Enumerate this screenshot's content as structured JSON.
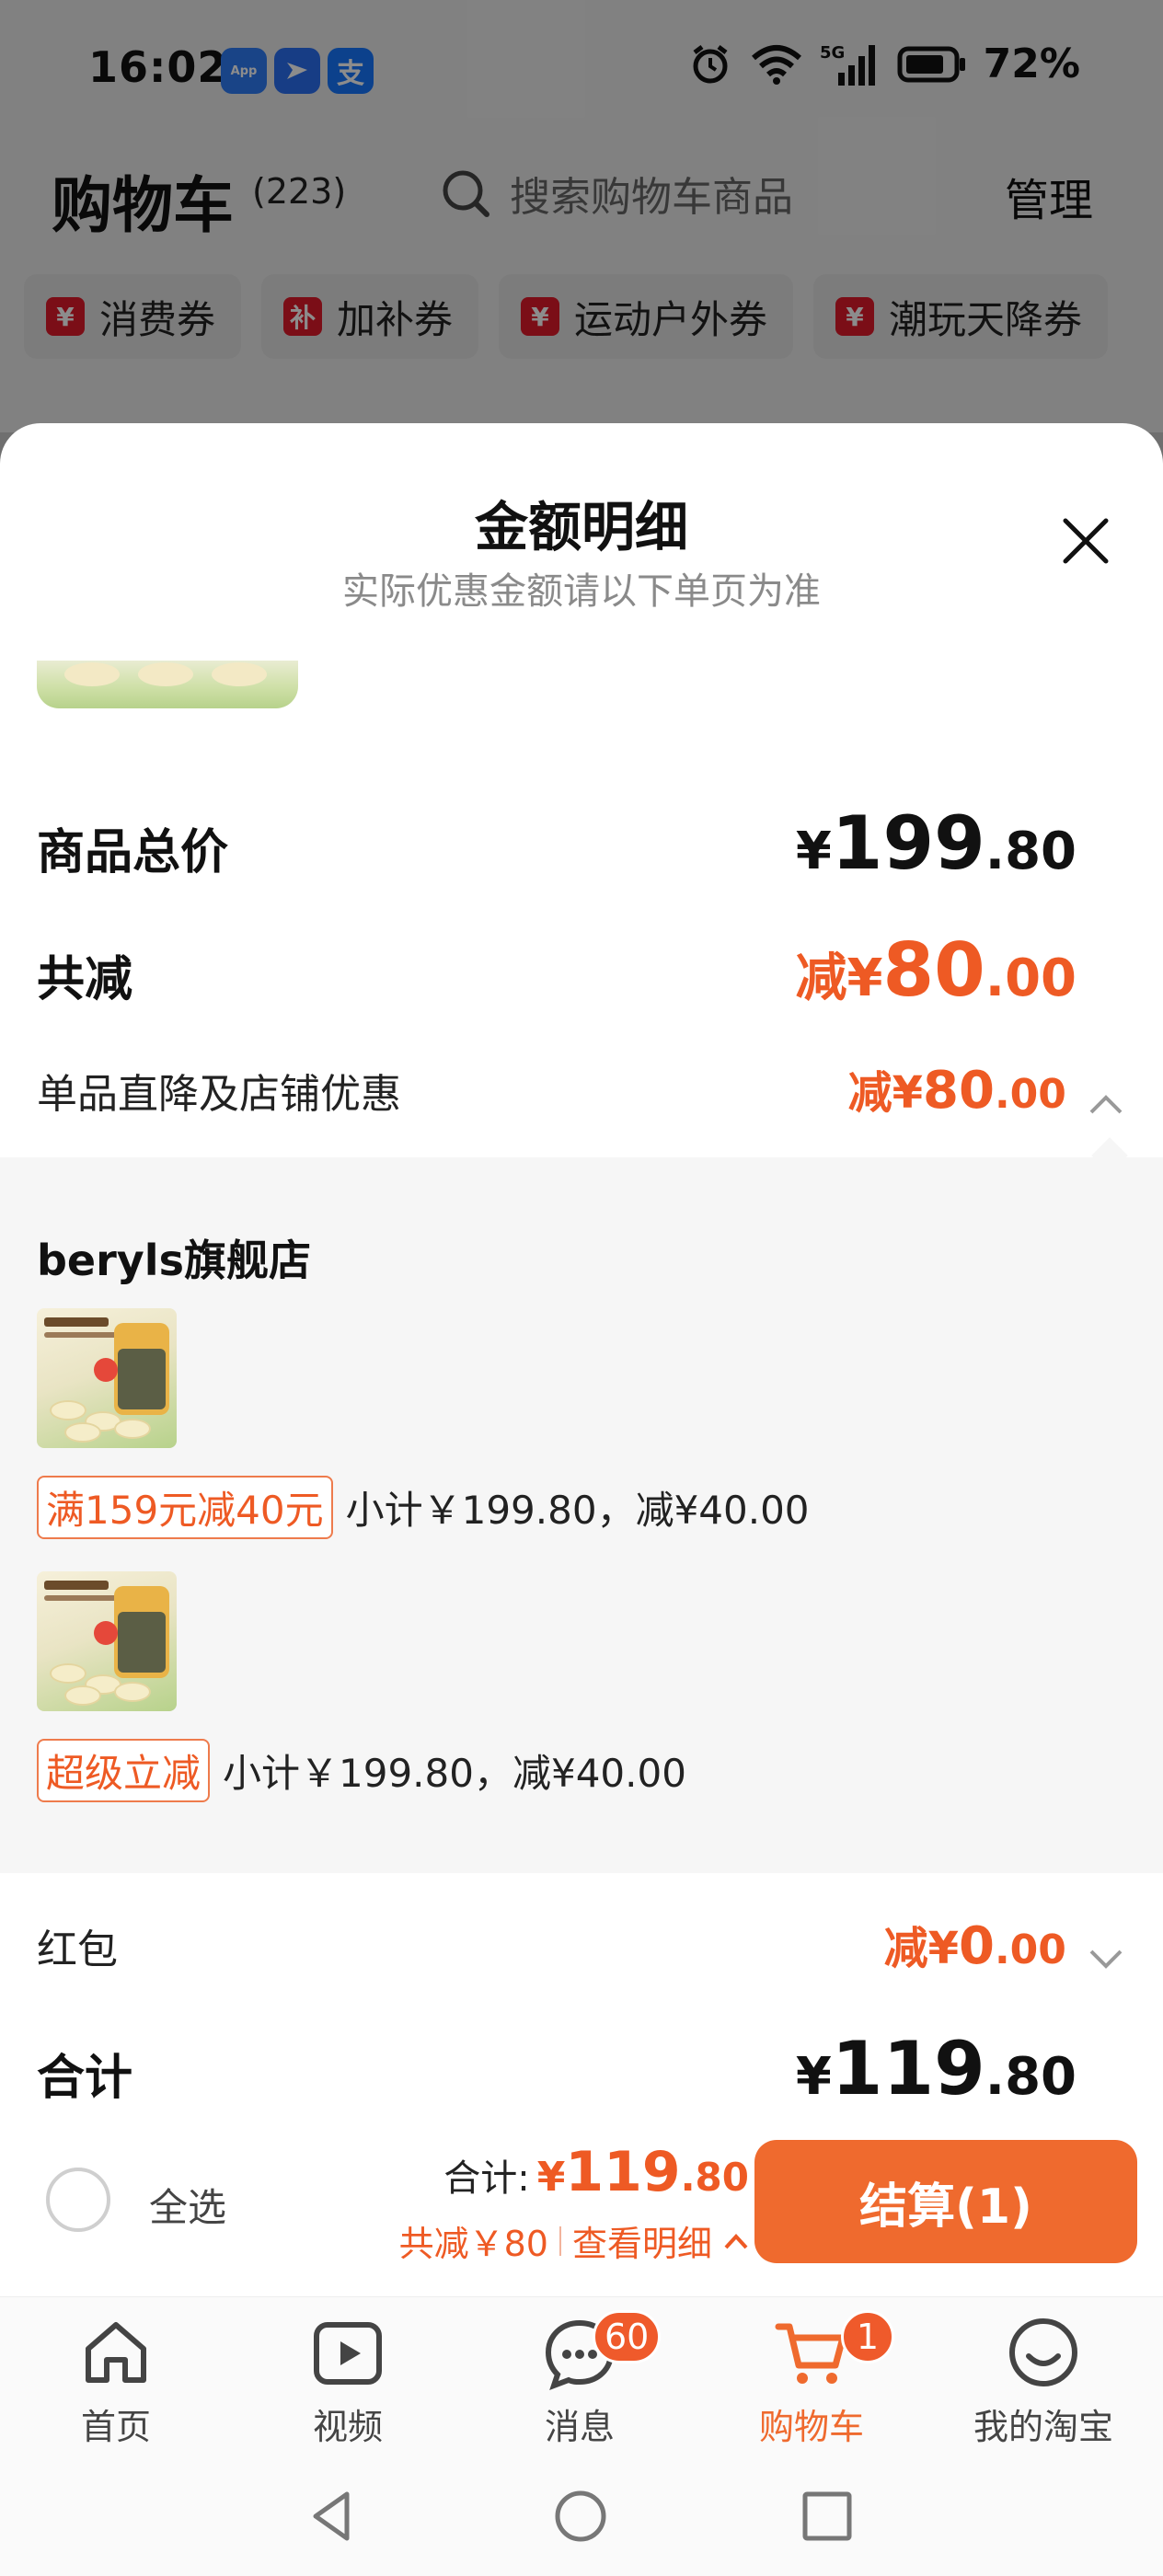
{
  "status_bar": {
    "time": "16:02",
    "apps": [
      {
        "name": "app-market-icon",
        "label": "App\nMarket"
      },
      {
        "name": "feishu-icon",
        "label": ""
      },
      {
        "name": "alipay-icon",
        "label": "支"
      }
    ],
    "network": "5G",
    "battery": "72%"
  },
  "header": {
    "title": "购物车",
    "count": "(223)",
    "search_placeholder": "搜索购物车商品",
    "manage": "管理"
  },
  "coupons": [
    {
      "icon": "¥",
      "label": "消费券"
    },
    {
      "icon": "补",
      "label": "加补券"
    },
    {
      "icon": "¥",
      "label": "运动户外券"
    },
    {
      "icon": "¥",
      "label": "潮玩天降券"
    }
  ],
  "sheet": {
    "title": "金额明细",
    "subtitle": "实际优惠金额请以下单页为准",
    "goods_total": {
      "label": "商品总价",
      "currency": "¥",
      "int": "199",
      "dec": ".80"
    },
    "total_discount": {
      "label": "共减",
      "prefix": "减",
      "currency": "¥",
      "int": "80",
      "dec": ".00"
    },
    "item_discount": {
      "label": "单品直降及店铺优惠",
      "prefix": "减",
      "currency": "¥",
      "int": "80",
      "dec": ".00"
    },
    "shop": {
      "name": "beryls旗舰店",
      "lines": [
        {
          "tag": "满159元减40元",
          "text": "小计￥199.80，减¥40.00"
        },
        {
          "tag": "超级立减",
          "text": "小计￥199.80，减¥40.00"
        }
      ]
    },
    "red_packet": {
      "label": "红包",
      "prefix": "减",
      "currency": "¥",
      "int": "0",
      "dec": ".00"
    },
    "sum": {
      "label": "合计",
      "currency": "¥",
      "int": "119",
      "dec": ".80"
    }
  },
  "checkout": {
    "select_all": "全选",
    "total_label": "合计:",
    "currency": "¥",
    "int": "119",
    "dec": ".80",
    "saved": "共减￥80",
    "view_detail": "查看明细",
    "button": "结算(1)"
  },
  "tabbar": [
    {
      "label": "首页",
      "icon": "home-icon"
    },
    {
      "label": "视频",
      "icon": "video-icon"
    },
    {
      "label": "消息",
      "icon": "message-icon",
      "badge": "60"
    },
    {
      "label": "购物车",
      "icon": "cart-icon",
      "badge": "1",
      "active": true
    },
    {
      "label": "我的淘宝",
      "icon": "profile-icon"
    }
  ],
  "colors": {
    "accent": "#ef6a2e",
    "discount_red": "#ee5a24",
    "coupon_red": "#e11a2a"
  }
}
